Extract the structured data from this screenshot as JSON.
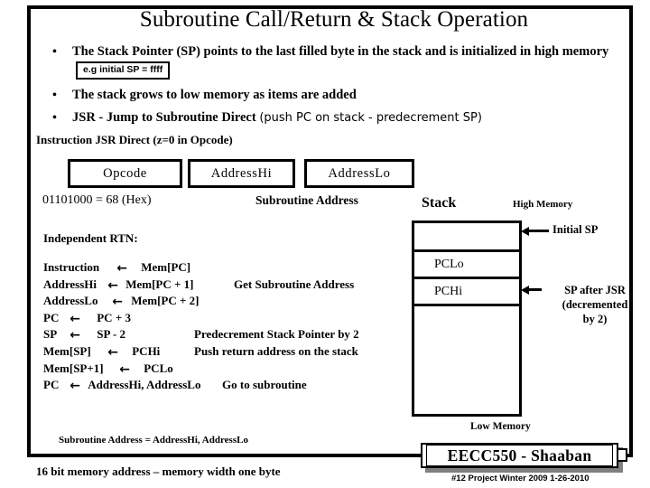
{
  "slide": {
    "title": "Subroutine Call/Return & Stack Operation",
    "bullets": [
      {
        "marker": "•",
        "text_before_box": "The Stack Pointer (SP) points to the last filled byte in the stack and is initialized in high memory",
        "box_text": "e.g initial SP = ffff",
        "sub_text": ""
      },
      {
        "marker": "•",
        "text_before_box": "The stack grows to low memory as items are added",
        "box_text": "",
        "sub_text": ""
      },
      {
        "marker": "•",
        "text_before_box": "JSR - Jump to Subroutine Direct",
        "box_text": "",
        "sub_text": "(push PC on stack - predecrement SP)"
      }
    ],
    "instruction_line": "Instruction  JSR Direct (z=0 in Opcode)",
    "fields": [
      {
        "label": "Opcode"
      },
      {
        "label": "AddressHi"
      },
      {
        "label": "AddressLo"
      }
    ],
    "opcode_hex": "01101000 = 68 (Hex)",
    "subroutine_address_label": "Subroutine Address",
    "rtn": {
      "heading": "Independent RTN:",
      "arrow": "←",
      "rows": [
        {
          "lhs": "Instruction",
          "rhs": "Mem[PC]",
          "note": ""
        },
        {
          "lhs": "AddressHi",
          "rhs": "Mem[PC + 1]",
          "note": "Get Subroutine Address"
        },
        {
          "lhs": "AddressLo",
          "rhs": "Mem[PC + 2]",
          "note": ""
        },
        {
          "lhs": "PC",
          "rhs": "PC + 3",
          "note": ""
        },
        {
          "lhs": "SP",
          "rhs": "SP - 2",
          "note": "Predecrement Stack Pointer by 2"
        },
        {
          "lhs": "Mem[SP]",
          "rhs": "PCHi",
          "note": "Push return address on the stack"
        },
        {
          "lhs": "Mem[SP+1]",
          "rhs": "PCLo",
          "note": ""
        },
        {
          "lhs": "PC",
          "rhs": "AddressHi, AddressLo",
          "note": "Go to subroutine"
        }
      ]
    },
    "stack": {
      "title": "Stack",
      "high_memory": "High Memory",
      "low_memory": "Low Memory",
      "cells": [
        {
          "label": ""
        },
        {
          "label": "PCLo"
        },
        {
          "label": "PCHi"
        }
      ],
      "annotations": {
        "initial_sp": "Initial SP",
        "sp_after_jsr_line1": "SP after JSR",
        "sp_after_jsr_line2": "(decremented",
        "sp_after_jsr_line3": "by 2)"
      }
    },
    "notes": {
      "subroutine_address_eq": "Subroutine Address = AddressHi, AddressLo",
      "memory_width": "16 bit memory address – memory width one byte"
    },
    "footer": {
      "badge": "EECC550 - Shaaban",
      "subline": "#12  Project  Winter 2009  1-26-2010"
    },
    "colors": {
      "ink": "#000000",
      "page": "#ffffff",
      "shadow": "#808080"
    }
  }
}
